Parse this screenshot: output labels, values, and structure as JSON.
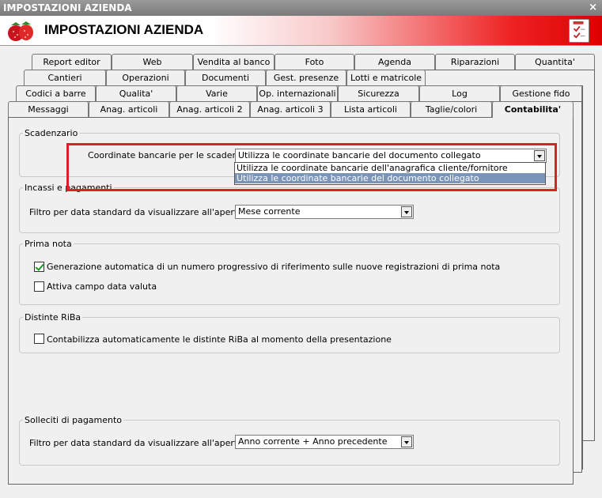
{
  "window": {
    "title": "IMPOSTAZIONI AZIENDA",
    "close_glyph": "×",
    "header_title": "IMPOSTAZIONI AZIENDA",
    "logo_icon": "strawberry-icon",
    "header_icon": "checklist-icon",
    "accent_color": "#e02020"
  },
  "tabs": {
    "row1": [
      "Report editor",
      "Web",
      "Vendita al banco",
      "Foto",
      "Agenda",
      "Riparazioni",
      "Quantita'"
    ],
    "row2": [
      "Cantieri",
      "Operazioni",
      "Documenti",
      "Gest. presenze",
      "Lotti e matricole"
    ],
    "row3": [
      "Codici a barre",
      "Qualita'",
      "Varie",
      "Op. internazionali",
      "Sicurezza",
      "Log",
      "Gestione fido"
    ],
    "row4": [
      "Messaggi",
      "Anag. articoli",
      "Anag. articoli 2",
      "Anag. articoli 3",
      "Lista articoli",
      "Taglie/colori",
      "Contabilita'"
    ],
    "active": "Contabilita'"
  },
  "scadenzario": {
    "legend": "Scadenzario",
    "label": "Coordinate bancarie per le scadenze :",
    "value": "Utilizza le coordinate bancarie del documento collegato",
    "options": [
      "Utilizza le coordinate bancarie dell'anagrafica cliente/fornitore",
      "Utilizza le coordinate bancarie del documento collegato"
    ],
    "selected_index": 1
  },
  "incassi": {
    "legend": "Incassi e pagamenti",
    "label": "Filtro per data standard da visualizzare all'apertura :",
    "value": "Mese corrente"
  },
  "prima_nota": {
    "legend": "Prima nota",
    "opt1_label": "Generazione automatica di un numero progressivo di riferimento sulle nuove registrazioni di prima nota",
    "opt1_checked": true,
    "opt2_label": "Attiva campo data valuta",
    "opt2_checked": false
  },
  "riba": {
    "legend": "Distinte RiBa",
    "opt_label": "Contabilizza automaticamente le distinte RiBa al momento della presentazione",
    "opt_checked": false
  },
  "solleciti": {
    "legend": "Solleciti di pagamento",
    "label": "Filtro per data standard da visualizzare all'apertura :",
    "value": "Anno corrente + Anno precedente"
  }
}
